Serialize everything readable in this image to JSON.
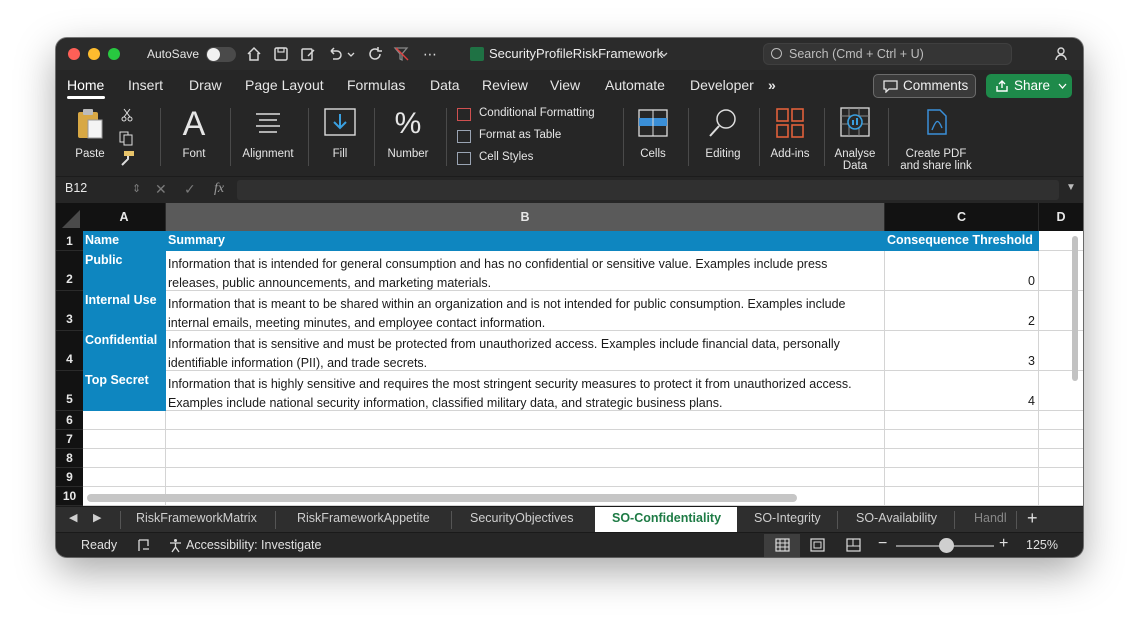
{
  "title_bar": {
    "autosave_label": "AutoSave",
    "document_title": "SecurityProfileRiskFramework",
    "search_placeholder": "Search (Cmd + Ctrl + U)"
  },
  "ribbon_tabs": [
    "Home",
    "Insert",
    "Draw",
    "Page Layout",
    "Formulas",
    "Data",
    "Review",
    "View",
    "Automate",
    "Developer"
  ],
  "ribbon_more": "»",
  "comments_label": "Comments",
  "share_label": "Share",
  "ribbon": {
    "paste": "Paste",
    "font": "Font",
    "alignment": "Alignment",
    "fill": "Fill",
    "number": "Number",
    "conditional_formatting": "Conditional Formatting",
    "format_as_table": "Format as Table",
    "cell_styles": "Cell Styles",
    "cells": "Cells",
    "editing": "Editing",
    "addins": "Add-ins",
    "analyse_data_1": "Analyse",
    "analyse_data_2": "Data",
    "create_pdf_1": "Create PDF",
    "create_pdf_2": "and share link"
  },
  "formula_bar": {
    "name_box": "B12",
    "fx": "fx"
  },
  "columns": [
    "A",
    "B",
    "C",
    "D"
  ],
  "rows": [
    "1",
    "2",
    "3",
    "4",
    "5",
    "6",
    "7",
    "8",
    "9",
    "10"
  ],
  "table": {
    "headers": [
      "Name",
      "Summary",
      "Consequence Threshold"
    ],
    "rows": [
      {
        "name": "Public",
        "summary_line1": "Information that is intended for general consumption and has no confidential or sensitive value. Examples include press",
        "summary_line2": "releases, public announcements, and marketing materials.",
        "threshold": "0"
      },
      {
        "name": "Internal Use",
        "summary_line1": "Information that is meant to be shared within an organization and is not intended for public consumption. Examples include",
        "summary_line2": "internal emails, meeting minutes, and employee contact information.",
        "threshold": "2"
      },
      {
        "name": "Confidential",
        "summary_line1": "Information that is sensitive and must be protected from unauthorized access. Examples include financial data, personally",
        "summary_line2": "identifiable information (PII), and trade secrets.",
        "threshold": "3"
      },
      {
        "name": "Top Secret",
        "summary_line1": "Information that is highly sensitive and requires the most stringent security measures to protect it from unauthorized access.",
        "summary_line2": "Examples include national security information, classified military data, and strategic business plans.",
        "threshold": "4"
      }
    ]
  },
  "sheet_tabs": [
    "RiskFrameworkMatrix",
    "RiskFrameworkAppetite",
    "SecurityObjectives",
    "SO-Confidentiality",
    "SO-Integrity",
    "SO-Availability",
    "Handl"
  ],
  "active_sheet": "SO-Confidentiality",
  "status": {
    "ready": "Ready",
    "accessibility": "Accessibility: Investigate",
    "zoom": "125%",
    "zoom_percent": 125
  },
  "colors": {
    "header_blue": "#0e86c0",
    "share_green": "#1e8a4a",
    "active_sheet_text": "#1e7b45"
  }
}
